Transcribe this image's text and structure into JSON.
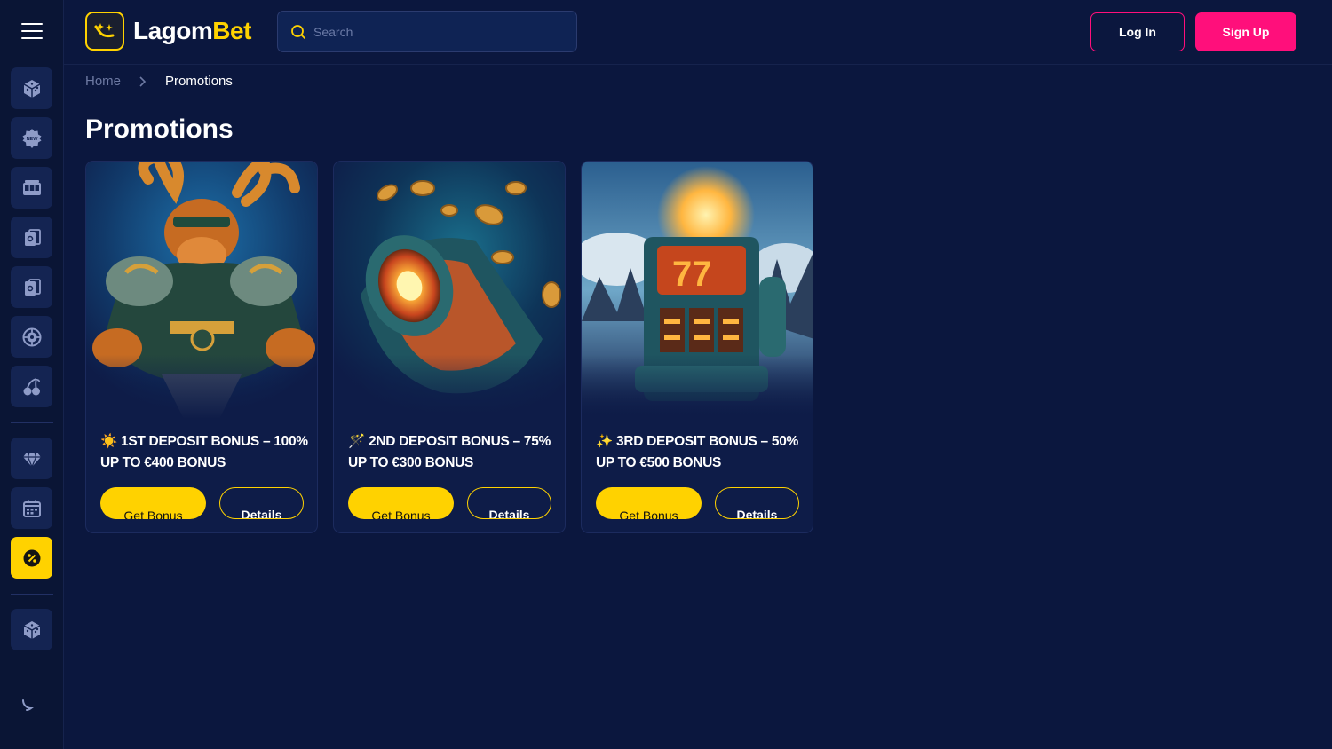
{
  "header": {
    "logo": {
      "part1": "Lagom",
      "part2": "Bet"
    },
    "search_placeholder": "Search",
    "login_label": "Log In",
    "signup_label": "Sign Up"
  },
  "sidebar": {
    "items": [
      {
        "icon": "dice-icon"
      },
      {
        "icon": "new-badge-icon"
      },
      {
        "icon": "slot-machine-icon"
      },
      {
        "icon": "cards-icon"
      },
      {
        "icon": "live-cards-icon"
      },
      {
        "icon": "roulette-icon"
      },
      {
        "icon": "cherries-icon"
      },
      {
        "icon": "diamond-icon"
      },
      {
        "icon": "calendar-icon"
      },
      {
        "icon": "promotion-percent-icon",
        "active": true
      },
      {
        "icon": "dice-icon"
      }
    ],
    "theme_toggle_icon": "moon-icon"
  },
  "breadcrumb": {
    "home": "Home",
    "current": "Promotions"
  },
  "page_title": "Promotions",
  "promotions": [
    {
      "emoji": "☀️",
      "title": "1ST DEPOSIT BONUS – 100% UP TO €400 BONUS",
      "get_label": "Get Bonus",
      "details_label": "Details"
    },
    {
      "emoji": "🪄",
      "title": "2ND DEPOSIT BONUS – 75% UP TO €300 BONUS",
      "get_label": "Get Bonus",
      "details_label": "Details"
    },
    {
      "emoji": "✨",
      "title": "3RD DEPOSIT BONUS – 50% UP TO €500 BONUS",
      "get_label": "Get Bonus",
      "details_label": "Details"
    }
  ],
  "colors": {
    "background": "#0b173e",
    "accent_yellow": "#ffd200",
    "accent_pink": "#ff0f7b"
  }
}
